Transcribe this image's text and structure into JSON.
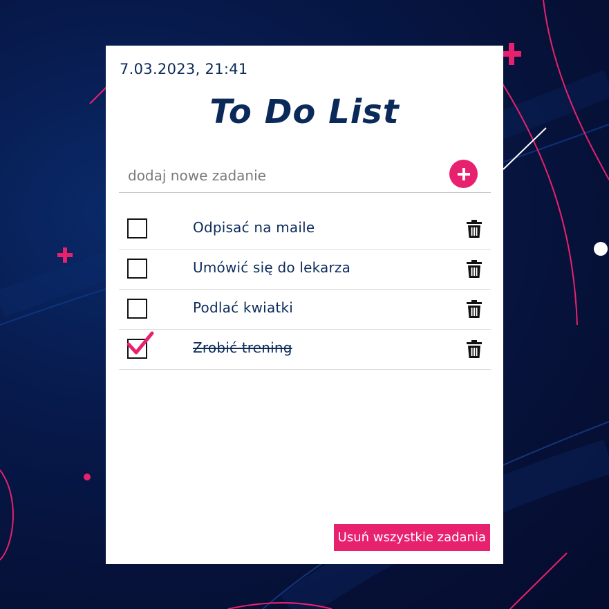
{
  "datetime": "7.03.2023, 21:41",
  "title": "To Do List",
  "add": {
    "placeholder": "dodaj nowe zadanie",
    "value": "",
    "button_icon": "plus-icon"
  },
  "tasks": [
    {
      "label": "Odpisać na maile",
      "done": false
    },
    {
      "label": "Umówić się do lekarza",
      "done": false
    },
    {
      "label": "Podlać kwiatki",
      "done": false
    },
    {
      "label": "Zrobić trening",
      "done": true
    }
  ],
  "clear_label": "Usuń wszystkie zadania",
  "icons": {
    "delete": "trash-icon",
    "check": "checkmark-icon"
  },
  "colors": {
    "accent": "#e8216f",
    "text": "#0b2a5a",
    "background": "#06123a",
    "card": "#ffffff"
  }
}
